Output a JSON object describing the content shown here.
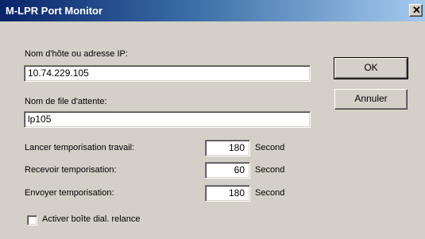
{
  "window": {
    "title": "M-LPR Port Monitor",
    "close_glyph": "✕"
  },
  "form": {
    "host_label": "Nom d'hôte ou adresse IP:",
    "host_value": "10.74.229.105",
    "queue_label": "Nom de file d'attente:",
    "queue_value": "lp105",
    "timeouts": [
      {
        "label": "Lancer temporisation travail:",
        "value": "180",
        "unit": "Second"
      },
      {
        "label": "Recevoir temporisation:",
        "value": "60",
        "unit": "Second"
      },
      {
        "label": "Envoyer temporisation:",
        "value": "180",
        "unit": "Second"
      }
    ],
    "checkbox_label": "Activer boîte dial. relance",
    "checkbox_checked": false
  },
  "buttons": {
    "ok": "OK",
    "cancel": "Annuler"
  }
}
